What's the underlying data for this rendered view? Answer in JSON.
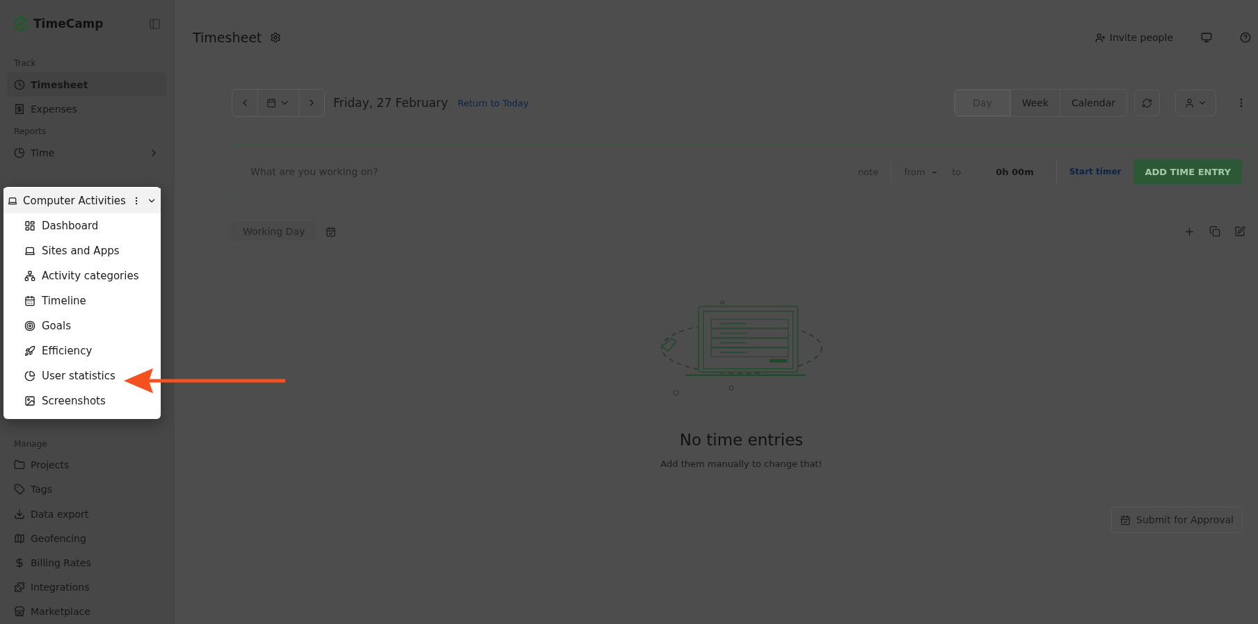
{
  "sidebar": {
    "logo": "TimeCamp",
    "sections": [
      {
        "label": "Track",
        "items": [
          {
            "label": "Timesheet",
            "selected": true
          },
          {
            "label": "Expenses",
            "selected": false
          }
        ]
      },
      {
        "label": "Reports",
        "items": [
          {
            "label": "Time",
            "selected": false
          }
        ]
      },
      {
        "label": "Manage",
        "items": [
          {
            "label": "Projects",
            "selected": false
          },
          {
            "label": "Tags",
            "selected": false
          },
          {
            "label": "Data export",
            "selected": false
          },
          {
            "label": "Geofencing",
            "selected": false
          },
          {
            "label": "Billing Rates",
            "selected": false
          },
          {
            "label": "Integrations",
            "selected": false
          },
          {
            "label": "Marketplace",
            "selected": false
          }
        ]
      }
    ]
  },
  "popup": {
    "title": "Computer Activities",
    "expanded": true,
    "items": [
      {
        "label": "Dashboard",
        "selected": false
      },
      {
        "label": "Sites and Apps",
        "selected": false
      },
      {
        "label": "Activity categories",
        "selected": false
      },
      {
        "label": "Timeline",
        "selected": false
      },
      {
        "label": "Goals",
        "selected": false
      },
      {
        "label": "Efficiency",
        "selected": false
      },
      {
        "label": "User statistics",
        "selected": false,
        "pointed": true
      },
      {
        "label": "Screenshots",
        "selected": false
      }
    ]
  },
  "header": {
    "title": "Timesheet",
    "invite": "Invite people"
  },
  "toolbar": {
    "date": "Friday, 27 February",
    "return_link": "Return to Today",
    "views": [
      {
        "label": "Day",
        "selected": true
      },
      {
        "label": "Week",
        "selected": false
      },
      {
        "label": "Calendar",
        "selected": false
      }
    ]
  },
  "entry": {
    "placeholder": "What are you working on?",
    "note": "note",
    "from": "from",
    "dash": "–",
    "to": "to",
    "duration": "0h 00m",
    "start_timer": "Start timer",
    "add": "ADD TIME ENTRY"
  },
  "day": {
    "label": "Working Day"
  },
  "empty": {
    "title": "No time entries",
    "subtitle": "Add them manually to change that!"
  },
  "submit": "Submit for Approval"
}
